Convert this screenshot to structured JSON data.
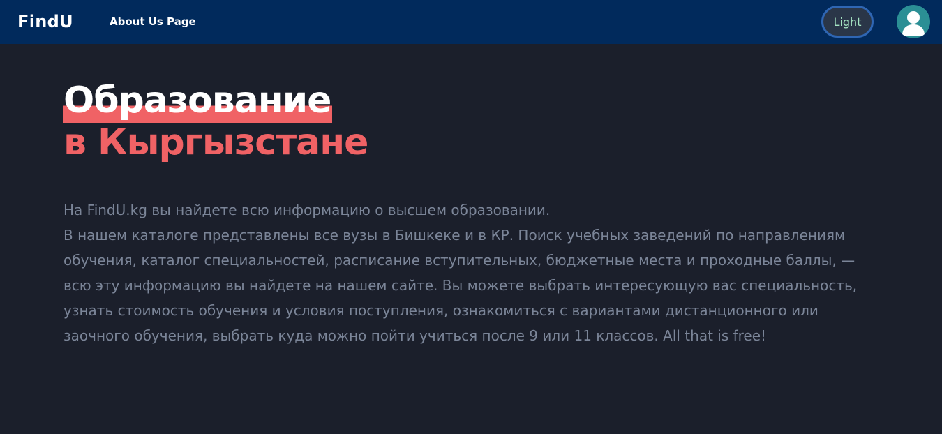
{
  "header": {
    "logo": "FindU",
    "nav_link": "About Us Page",
    "theme_toggle_label": "Light",
    "avatar_icon": "user-avatar-icon"
  },
  "hero": {
    "title_line1": "Образование",
    "title_line2": "в Кыргызстане",
    "accent_color": "#f06265",
    "description_line1": "На FindU.kg вы найдете всю информацию о высшем образовании.",
    "description_paragraph": "В нашем каталоге представлены все вузы в Бишкеке и в КР. Поиск учебных заведений по направлениям обучения, каталог специальностей, расписание вступительных, бюджетные места и проходные баллы, — всю эту информацию вы найдете на нашем сайте. Вы можете выбрать интересующую вас специальность, узнать стоимость обучения и условия поступления, ознакомиться с вариантами дистанционного или заочного обучения, выбрать куда можно пойти учиться после 9 или 11 классов. All that is free!"
  },
  "colors": {
    "navbar_bg": "#012a5c",
    "page_bg": "#1b1f2b",
    "body_text": "#7b8598"
  }
}
